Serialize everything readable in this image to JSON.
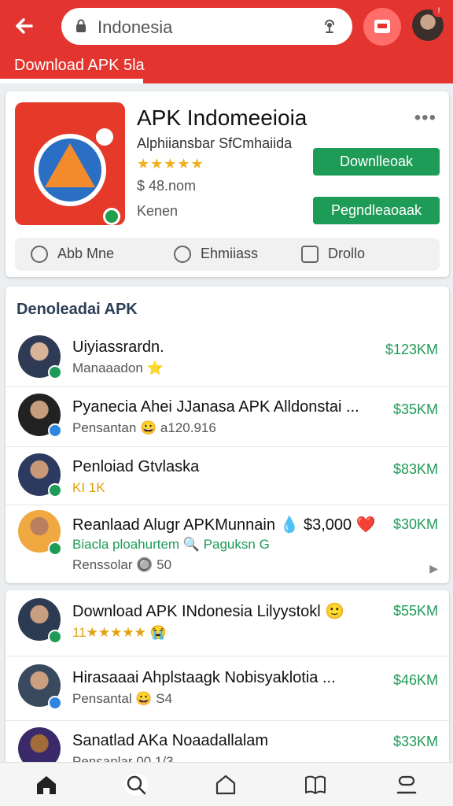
{
  "header": {
    "search_query": "Indonesia",
    "tab_label": "Download APK 5la",
    "notification_count": "!"
  },
  "app": {
    "title": "APK Indomeeioia",
    "developer": "Alphiiansbar SfCmhaiida",
    "stars": "★★★★★",
    "size": "$ 48.nom",
    "meta": "Kenen",
    "download_label": "Downlleoak",
    "secondary_label": "Pegndleaoaak",
    "actions": [
      {
        "label": "Abb Mne"
      },
      {
        "label": "Ehmiiass"
      },
      {
        "label": "Drollo"
      }
    ]
  },
  "section": {
    "title": "Denoleadai APK"
  },
  "list1": [
    {
      "title": "Uiyiassrardn.",
      "sub": "Manaaadon ⭐",
      "size": "$123KM",
      "badge": "green"
    },
    {
      "title": "Pyanecia Ahei JJanasa APK Alldonstai ...",
      "sub": "Pensantan 😀 a120.916",
      "size": "$35KM",
      "badge": "blue"
    },
    {
      "title": "Penloiad Gtvlaska",
      "sub": "KI 1K",
      "size": "$83KM",
      "badge": "green"
    },
    {
      "title": "Reanlaad Alugr APKMunnain 💧 $3,000 ❤️",
      "sub": "Biacla ploahurtem 🔍 Paguksn G",
      "sub2": "Renssolar 🔘 50",
      "size": "$30KM",
      "badge": "green"
    }
  ],
  "list2": [
    {
      "title": "Download APK INdonesia Lilyystokl 🙂",
      "sub": "11★★★★★ 😭",
      "size": "$55KM",
      "badge": "green"
    },
    {
      "title": "Hirasaaai Ahplstaagk Nobisyaklotia ...",
      "sub": "Pensantal 😀 S4",
      "size": "$46KM",
      "badge": "blue"
    },
    {
      "title": "Sanatlad AKa Noaadallalam",
      "sub": "Pensanlar 00 1/3",
      "size": "$33KM",
      "badge": "green"
    }
  ],
  "icons": {
    "back": "arrow-left-icon",
    "lock": "lock-icon",
    "mic": "mic-icon",
    "header_button": "screen-cast-icon",
    "more": "more-horizontal-icon",
    "nav": [
      "home-icon",
      "search-icon",
      "shop-icon",
      "book-icon",
      "profile-icon"
    ]
  },
  "colors": {
    "header": "#e3342f",
    "accent_green": "#1e9b57",
    "star": "#f2b01e",
    "section_title": "#2c3e56"
  }
}
